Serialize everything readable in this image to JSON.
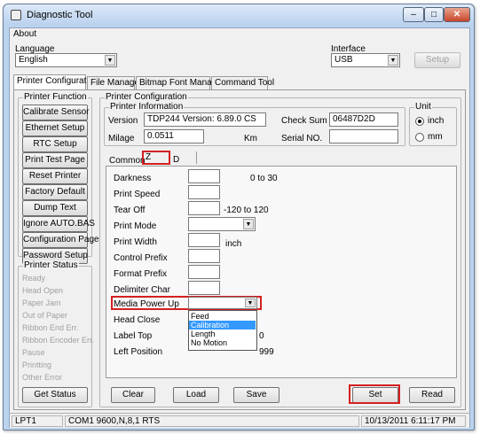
{
  "window": {
    "title": "Diagnostic Tool",
    "controls": {
      "minimize": "–",
      "maximize": "□",
      "close": "✕"
    }
  },
  "menu": {
    "about": "About"
  },
  "language": {
    "label": "Language",
    "value": "English"
  },
  "interface": {
    "label": "Interface",
    "value": "USB",
    "setup_button": "Setup"
  },
  "tabs": [
    "Printer Configuration",
    "File Manager",
    "Bitmap Font Manager",
    "Command Tool"
  ],
  "printer_function": {
    "label": "Printer Function",
    "buttons": [
      "Calibrate Sensor",
      "Ethernet Setup",
      "RTC Setup",
      "Print Test Page",
      "Reset Printer",
      "Factory Default",
      "Dump Text",
      "Ignore AUTO.BAS",
      "Configuration Page",
      "Password Setup"
    ]
  },
  "printer_status": {
    "label": "Printer Status",
    "items": [
      "Ready",
      "Head Open",
      "Paper Jam",
      "Out of Paper",
      "Ribbon End Err.",
      "Ribbon Encoder Err.",
      "Pause",
      "Printting",
      "Other Error"
    ],
    "get_status_button": "Get Status"
  },
  "printer_configuration": {
    "label": "Printer Configuration",
    "info": {
      "label": "Printer Information",
      "version_label": "Version",
      "version_value": "TDP244 Version: 6.89.0 CS",
      "checksum_label": "Check Sum",
      "checksum_value": "06487D2D",
      "milage_label": "Milage",
      "milage_value": "0.0511",
      "milage_unit": "Km",
      "serial_label": "Serial NO.",
      "serial_value": ""
    },
    "unit": {
      "label": "Unit",
      "options": [
        "inch",
        "mm"
      ],
      "selected": "inch"
    }
  },
  "subtabs": [
    "Common",
    "Z",
    "D"
  ],
  "settings": {
    "rows": [
      {
        "label": "Darkness",
        "value": "",
        "hint": "0 to 30"
      },
      {
        "label": "Print Speed",
        "value": "",
        "hint": ""
      },
      {
        "label": "Tear Off",
        "value": "",
        "hint": "-120 to 120"
      },
      {
        "label": "Print Mode",
        "value": "",
        "hint": ""
      },
      {
        "label": "Print Width",
        "value": "",
        "hint": "inch"
      },
      {
        "label": "Control Prefix",
        "value": "",
        "hint": ""
      },
      {
        "label": "Format Prefix",
        "value": "",
        "hint": ""
      },
      {
        "label": "Delimiter Char",
        "value": "",
        "hint": ""
      },
      {
        "label": "Media Power Up",
        "value": "",
        "hint": ""
      },
      {
        "label": "Head Close",
        "value": "",
        "hint": ""
      },
      {
        "label": "Label Top",
        "value": "",
        "hint": "0"
      },
      {
        "label": "Left Position",
        "value": "",
        "hint": "999"
      }
    ],
    "media_power_up_options": [
      "Feed",
      "Calibration",
      "Length",
      "No Motion"
    ],
    "media_power_up_highlighted": "Calibration"
  },
  "actions": {
    "clear": "Clear",
    "load": "Load",
    "save": "Save",
    "set": "Set",
    "read": "Read"
  },
  "statusbar": {
    "port": "LPT1",
    "com": "COM1 9600,N,8,1 RTS",
    "datetime": "10/13/2011 6:11:17 PM"
  },
  "colors": {
    "highlight_box": "#d42020",
    "selection": "#3399ff"
  }
}
